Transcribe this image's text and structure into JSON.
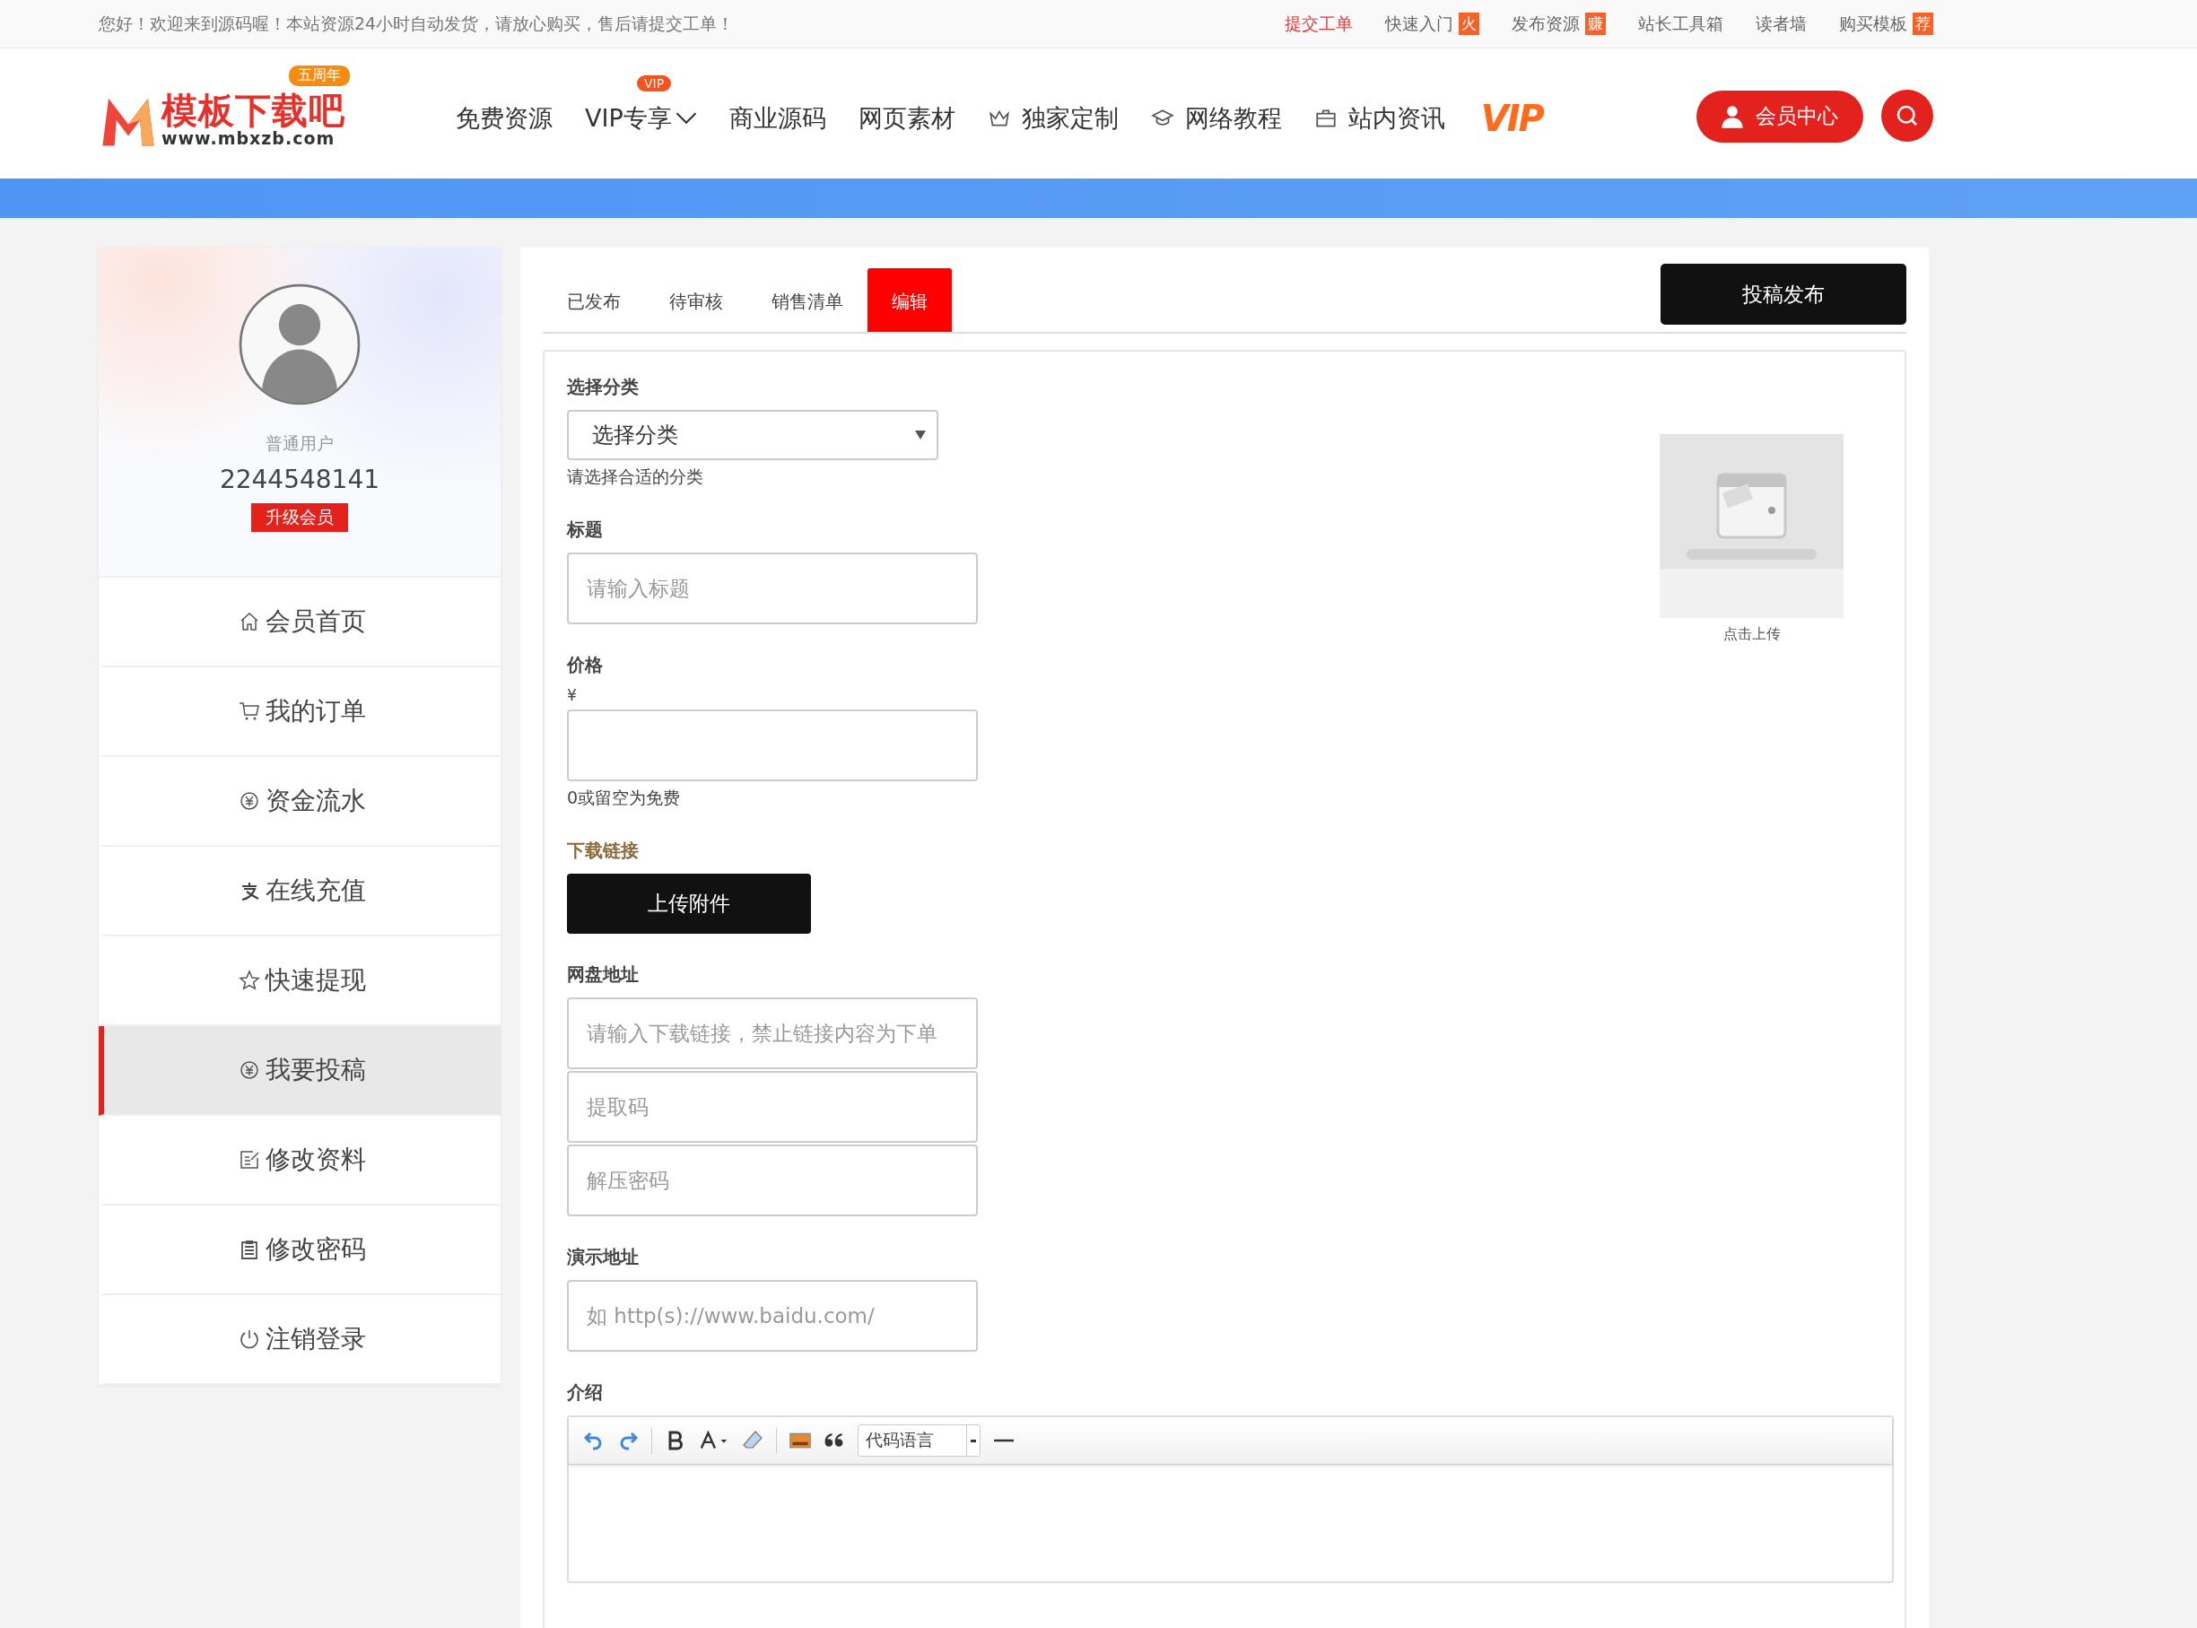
{
  "top_bar": {
    "greeting": "您好！欢迎来到源码喔！本站资源24小时自动发货，请放心购买，售后请提交工单！",
    "links": [
      {
        "label": "提交工单",
        "highlight": true
      },
      {
        "label": "快速入门",
        "badge": "火",
        "highlight": false
      },
      {
        "label": "发布资源",
        "badge": "赚",
        "highlight": false
      },
      {
        "label": "站长工具箱",
        "highlight": false
      },
      {
        "label": "读者墙",
        "highlight": false
      },
      {
        "label": "购买模板",
        "badge": "荐",
        "highlight": false
      }
    ]
  },
  "header": {
    "logo": {
      "name": "模板下载吧",
      "url": "www.mbxzb.com",
      "badge": "五周年"
    },
    "nav": [
      {
        "label": "免费资源"
      },
      {
        "label": "VIP专享",
        "badge": "VIP",
        "dropdown": true
      },
      {
        "label": "商业源码"
      },
      {
        "label": "网页素材"
      },
      {
        "label": "独家定制",
        "icon": true
      },
      {
        "label": "网络教程",
        "icon": true
      },
      {
        "label": "站内资讯",
        "icon": true
      },
      {
        "label": "VIP",
        "kind": "logo"
      }
    ],
    "member_button": "会员中心"
  },
  "sidebar": {
    "role": "普通用户",
    "user_id": "2244548141",
    "upgrade": "升级会员",
    "items": [
      {
        "label": "会员首页",
        "selected": false
      },
      {
        "label": "我的订单",
        "selected": false
      },
      {
        "label": "资金流水",
        "selected": false
      },
      {
        "label": "在线充值",
        "selected": false
      },
      {
        "label": "快速提现",
        "selected": false
      },
      {
        "label": "我要投稿",
        "selected": true
      },
      {
        "label": "修改资料",
        "selected": false
      },
      {
        "label": "修改密码",
        "selected": false
      },
      {
        "label": "注销登录",
        "selected": false
      }
    ]
  },
  "tabs": [
    {
      "label": "已发布",
      "selected": false
    },
    {
      "label": "待审核",
      "selected": false
    },
    {
      "label": "销售清单",
      "selected": false
    },
    {
      "label": "编辑",
      "selected": true
    }
  ],
  "submit_button": "投稿发布",
  "form": [
    {
      "kind": "select",
      "label": "选择分类",
      "value": "选择分类",
      "hint": "请选择合适的分类"
    },
    {
      "kind": "input",
      "label": "标题",
      "placeholder": "请输入标题"
    },
    {
      "kind": "input",
      "label": "价格",
      "prefix": "¥",
      "hint": "0或留空为免费"
    },
    {
      "kind": "upload",
      "label": "下载链接",
      "button": "上传附件"
    },
    {
      "kind": "inputs",
      "label": "网盘地址",
      "placeholders": [
        "请输入下载链接，禁止链接内容为下单",
        "提取码",
        "解压密码"
      ]
    },
    {
      "kind": "input",
      "label": "演示地址",
      "placeholder": "如 http(s)://www.baidu.com/"
    },
    {
      "kind": "editor",
      "label": "介绍",
      "code_language": "代码语言"
    }
  ],
  "thumbnail": {
    "kind": "picture",
    "caption": "点击上传"
  }
}
